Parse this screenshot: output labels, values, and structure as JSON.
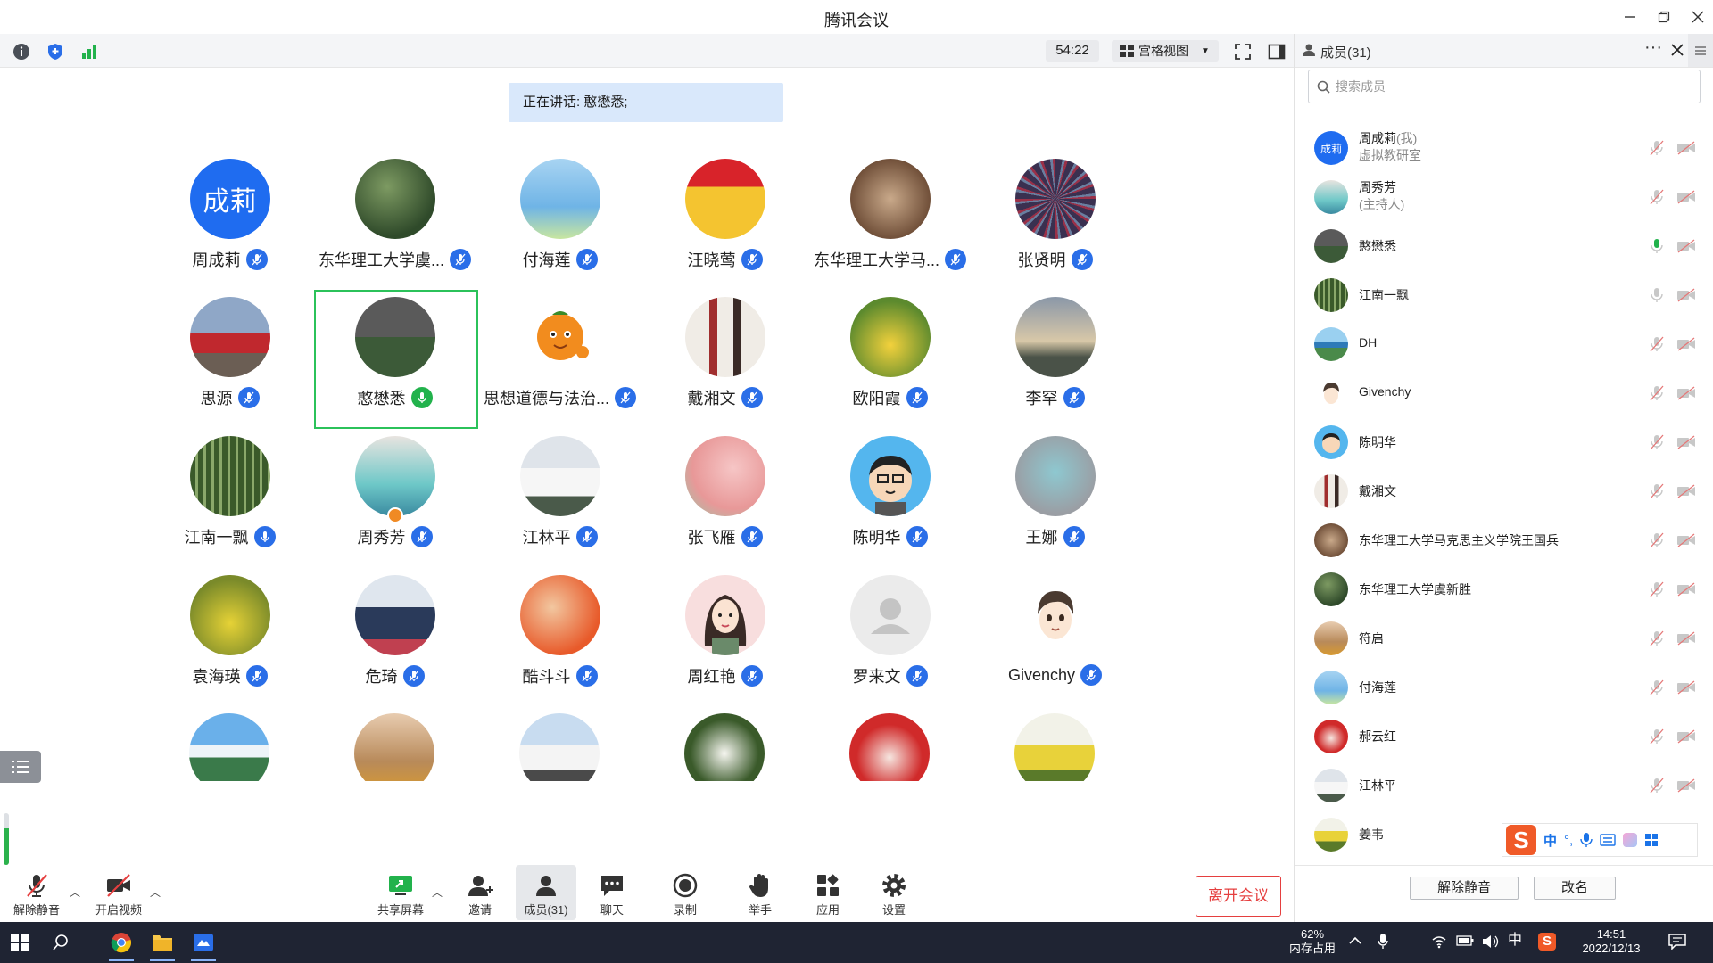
{
  "window": {
    "title": "腾讯会议"
  },
  "toolbar": {
    "timer": "54:22",
    "view_label": "宫格视图"
  },
  "speaking": {
    "text": "正在讲话: 憨懋悉;"
  },
  "participants": [
    {
      "name": "周成莉",
      "avatar_text": "成莉",
      "mic": "blue"
    },
    {
      "name": "东华理工大学虞...",
      "mic": "blue"
    },
    {
      "name": "付海莲",
      "mic": "blue"
    },
    {
      "name": "汪晓莺",
      "mic": "blue"
    },
    {
      "name": "东华理工大学马...",
      "mic": "blue"
    },
    {
      "name": "张贤明",
      "mic": "blue"
    },
    {
      "name": "思源",
      "mic": "blue"
    },
    {
      "name": "憨懋悉",
      "mic": "green",
      "selected": true
    },
    {
      "name": "思想道德与法治...",
      "mic": "blue"
    },
    {
      "name": "戴湘文",
      "mic": "blue"
    },
    {
      "name": "欧阳霞",
      "mic": "blue"
    },
    {
      "name": "李罕",
      "mic": "blue"
    },
    {
      "name": "江南一飘",
      "mic": "blue-on"
    },
    {
      "name": "周秀芳",
      "mic": "blue"
    },
    {
      "name": "江林平",
      "mic": "blue"
    },
    {
      "name": "张飞雁",
      "mic": "blue"
    },
    {
      "name": "陈明华",
      "mic": "blue"
    },
    {
      "name": "王娜",
      "mic": "blue"
    },
    {
      "name": "袁海瑛",
      "mic": "blue"
    },
    {
      "name": "危琦",
      "mic": "blue"
    },
    {
      "name": "酷斗斗",
      "mic": "blue"
    },
    {
      "name": "周红艳",
      "mic": "blue"
    },
    {
      "name": "罗来文",
      "mic": "blue"
    },
    {
      "name": "Givenchy",
      "mic": "blue"
    }
  ],
  "bottom": {
    "unmute": "解除静音",
    "start_video": "开启视频",
    "share": "共享屏幕",
    "invite": "邀请",
    "members": "成员(31)",
    "chat": "聊天",
    "record": "录制",
    "raise_hand": "举手",
    "apps": "应用",
    "settings": "设置",
    "leave": "离开会议"
  },
  "panel": {
    "title": "成员(31)",
    "search_placeholder": "搜索成员",
    "members": [
      {
        "name": "周成莉",
        "suffix": "(我)",
        "sub": "虚拟教研室",
        "avatar_text": "成莉",
        "mic": "muted"
      },
      {
        "name": "周秀芳",
        "sub": "(主持人)",
        "mic": "muted"
      },
      {
        "name": "憨懋悉",
        "mic": "speaking"
      },
      {
        "name": "江南一飘",
        "mic": "on"
      },
      {
        "name": "DH",
        "mic": "muted"
      },
      {
        "name": "Givenchy",
        "mic": "muted"
      },
      {
        "name": "陈明华",
        "mic": "muted"
      },
      {
        "name": "戴湘文",
        "mic": "muted"
      },
      {
        "name": "东华理工大学马克思主义学院王国兵",
        "mic": "muted"
      },
      {
        "name": "东华理工大学虞新胜",
        "mic": "muted"
      },
      {
        "name": "符启",
        "mic": "muted"
      },
      {
        "name": "付海莲",
        "mic": "muted"
      },
      {
        "name": "郝云红",
        "mic": "muted"
      },
      {
        "name": "江林平",
        "mic": "muted"
      },
      {
        "name": "姜韦",
        "mic": "muted"
      }
    ],
    "unmute_all": "解除静音",
    "rename": "改名"
  },
  "ime": {
    "lang": "中"
  },
  "taskbar": {
    "memory_percent": "62%",
    "memory_label": "内存占用",
    "ime_lang": "中",
    "time": "14:51",
    "date": "2022/12/13"
  },
  "colors": {
    "accent": "#2a6ee8",
    "speaking_green": "#22b24c",
    "leave_red": "#e53f3f",
    "speaking_banner": "#d9e8fb",
    "taskbar": "#1f2433"
  }
}
